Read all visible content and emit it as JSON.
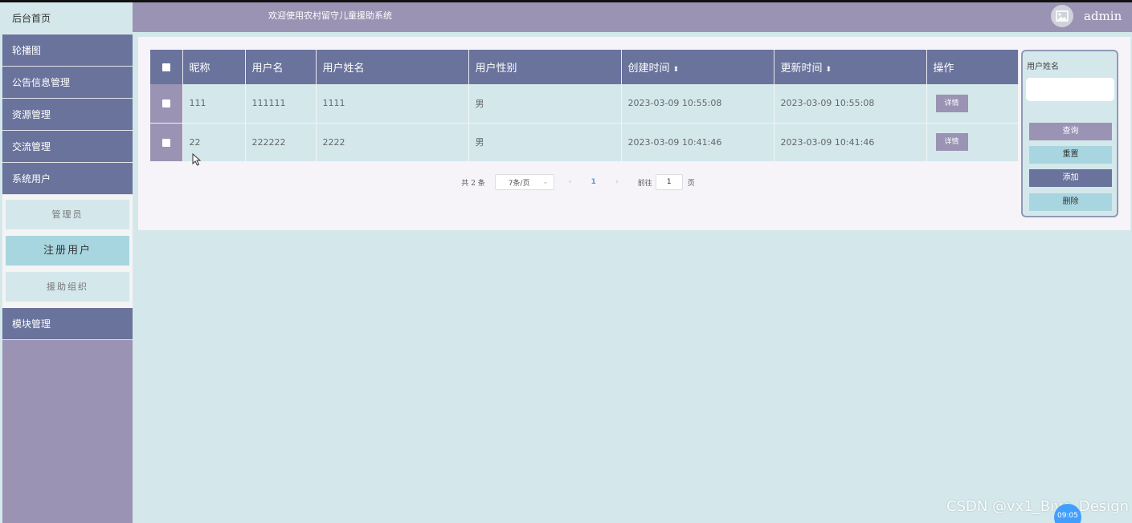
{
  "header": {
    "welcome": "欢迎使用农村留守儿童援助系统",
    "username": "admin",
    "avatar_icon": "image-icon"
  },
  "sidebar": {
    "home": "后台首页",
    "items": [
      {
        "label": "轮播图"
      },
      {
        "label": "公告信息管理"
      },
      {
        "label": "资源管理"
      },
      {
        "label": "交流管理"
      },
      {
        "label": "系统用户"
      }
    ],
    "submenu": [
      {
        "label": "管理员"
      },
      {
        "label": "注册用户"
      },
      {
        "label": "援助组织"
      }
    ],
    "after": [
      {
        "label": "模块管理"
      }
    ]
  },
  "table": {
    "columns": [
      "昵称",
      "用户名",
      "用户姓名",
      "用户性别",
      "创建时间",
      "更新时间",
      "操作"
    ],
    "rows": [
      {
        "nickname": "111",
        "username": "111111",
        "realname": "1111",
        "gender": "男",
        "created": "2023-03-09 10:55:08",
        "updated": "2023-03-09 10:55:08",
        "action": "详情"
      },
      {
        "nickname": "22",
        "username": "222222",
        "realname": "2222",
        "gender": "男",
        "created": "2023-03-09 10:41:46",
        "updated": "2023-03-09 10:41:46",
        "action": "详情"
      }
    ]
  },
  "pagination": {
    "total_text": "共 2 条",
    "page_size": "7条/页",
    "current_page": "1",
    "goto_label": "前往",
    "goto_value": "1",
    "page_unit": "页"
  },
  "search": {
    "label": "用户姓名",
    "query": "查询",
    "reset": "重置",
    "add": "添加",
    "delete": "删除"
  },
  "watermark": "CSDN @vx1_Biye_Design",
  "clock": "09:05",
  "colors": {
    "primary": "#6a739c",
    "secondary": "#9a93b3",
    "light": "#d4e8ec",
    "accent": "#a8d6e0"
  }
}
